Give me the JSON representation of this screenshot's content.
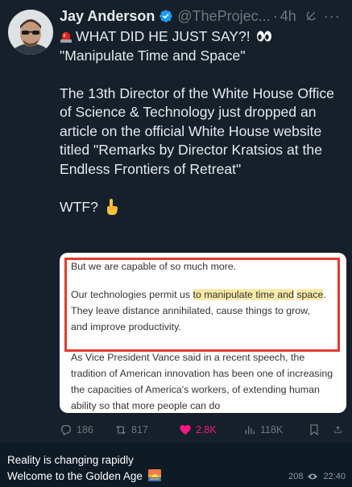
{
  "tweet": {
    "author_name": "Jay Anderson",
    "handle": "@TheProjec...",
    "separator": "·",
    "time": "4h",
    "more": "···",
    "line1": "WHAT DID HE JUST SAY?!",
    "line2": "\"Manipulate Time and Space\"",
    "para": "The 13th Director of the White House Office of Science & Technology just dropped an article on the official White House website titled \"Remarks by Director Kratsios at the Endless Frontiers of Retreat\"",
    "wtf": "WTF?"
  },
  "card": {
    "p1": "But we are capable of so much more.",
    "p2_a": "Our technologies permit us ",
    "p2_hl1": "to manipulate time and",
    "p2_hl2": "space",
    "p2_b": ". They leave distance annihilated, cause things to grow, and improve productivity.",
    "p3": "As Vice President Vance said in a recent speech, the tradition of American innovation has been one of increasing the capacities of America's workers, of extending human ability so that more people can do"
  },
  "actions": {
    "replies": "186",
    "reposts": "817",
    "likes": "2.8K",
    "views": "118K"
  },
  "colors": {
    "background": "#15202b",
    "text": "#e7e9ea",
    "muted": "#71767b",
    "verified": "#1d9bf0",
    "like": "#f91880",
    "highlight_box": "#e23b2e"
  },
  "message": {
    "line1": "Reality is changing rapidly",
    "line2": "Welcome to the Golden Age",
    "views": "208",
    "time": "22:40"
  }
}
